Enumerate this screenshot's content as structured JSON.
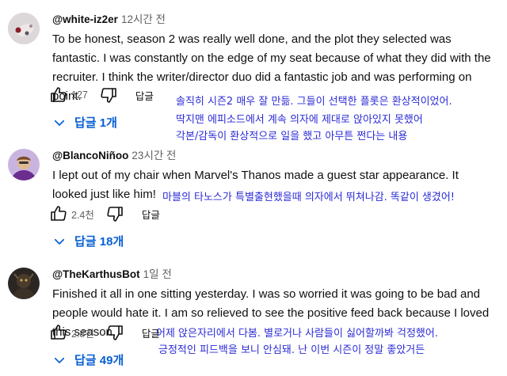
{
  "comments": [
    {
      "author": "@white-iz2er",
      "time": "12시간 전",
      "text": "To be honest, season 2 was really well done, and the plot they selected was fantastic. I was constantly on the edge of my seat because of what they did with the recruiter. I think the writer/director duo did a fantastic job and was performing on point.",
      "likes": "127",
      "reply_label": "답글",
      "replies_label": "답글 1개",
      "translation": [
        "솔직히 시즌2 매우 잘 만듦. 그들이 선택한 플롯은 환상적이었어.",
        "딱지맨 에피소드에서 계속 의자에 제대로 앉아있지 못했어",
        "각본/감독이 환상적으로 일을 했고 아무튼 쩐다는 내용"
      ]
    },
    {
      "author": "@BlancoNiñoo",
      "time": "23시간 전",
      "text": "I lept out of my chair when Marvel's Thanos made a guest star appearance. It looked just like him!",
      "likes": "2.4천",
      "reply_label": "답글",
      "replies_label": "답글 18개",
      "translation": [
        "마블의 타노스가 특별출현했을때 의자에서 뛰쳐나감. 똑같이 생겼어!"
      ]
    },
    {
      "author": "@TheKarthusBot",
      "time": "1일 전",
      "text": "Finished it all in one sitting yesterday. I was so worried it was going to be bad and people would hate it. I am so relieved to see the positive feed back because I loved this season.",
      "likes": "2.8천",
      "reply_label": "답글",
      "replies_label": "답글 49개",
      "translation": [
        "어제 앉은자리에서 다봄. 별로거나 사람들이 싫어할까봐 걱정했어.",
        "긍정적인 피드백을 보니 안심돼. 난 이번 시즌이 정말 좋았거든"
      ]
    }
  ]
}
